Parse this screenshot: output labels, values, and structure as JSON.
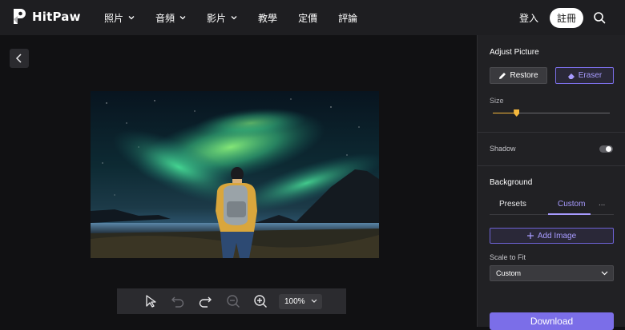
{
  "header": {
    "brand": "HitPaw",
    "nav": [
      {
        "label": "照片",
        "has_dropdown": true
      },
      {
        "label": "音頻",
        "has_dropdown": true
      },
      {
        "label": "影片",
        "has_dropdown": true
      },
      {
        "label": "教學",
        "has_dropdown": false
      },
      {
        "label": "定價",
        "has_dropdown": false
      },
      {
        "label": "評論",
        "has_dropdown": false
      }
    ],
    "login": "登入",
    "register": "註冊",
    "search_icon": "search-icon"
  },
  "canvas": {
    "back_icon": "chevron-left-icon",
    "image_description": "person with backpack in front of aurora",
    "toolbar": {
      "icons": [
        "select-arrow-icon",
        "undo-icon",
        "redo-icon",
        "zoom-out-icon",
        "zoom-in-icon"
      ],
      "zoom": "100%"
    }
  },
  "panel": {
    "adjust_title": "Adjust Picture",
    "restore_label": "Restore",
    "eraser_label": "Eraser",
    "size_label": "Size",
    "size_value_fraction": 0.2,
    "shadow_label": "Shadow",
    "shadow_on": false,
    "background_title": "Background",
    "tabs": [
      "Presets",
      "Custom"
    ],
    "active_tab": "Custom",
    "more_label": "...",
    "add_image_label": "Add Image",
    "scale_label": "Scale to Fit",
    "scale_value": "Custom",
    "download_label": "Download"
  },
  "colors": {
    "accent": "#7b6ee8",
    "slider": "#f5b83d",
    "panel_bg": "#212124",
    "topbar_bg": "#1e1e21"
  }
}
